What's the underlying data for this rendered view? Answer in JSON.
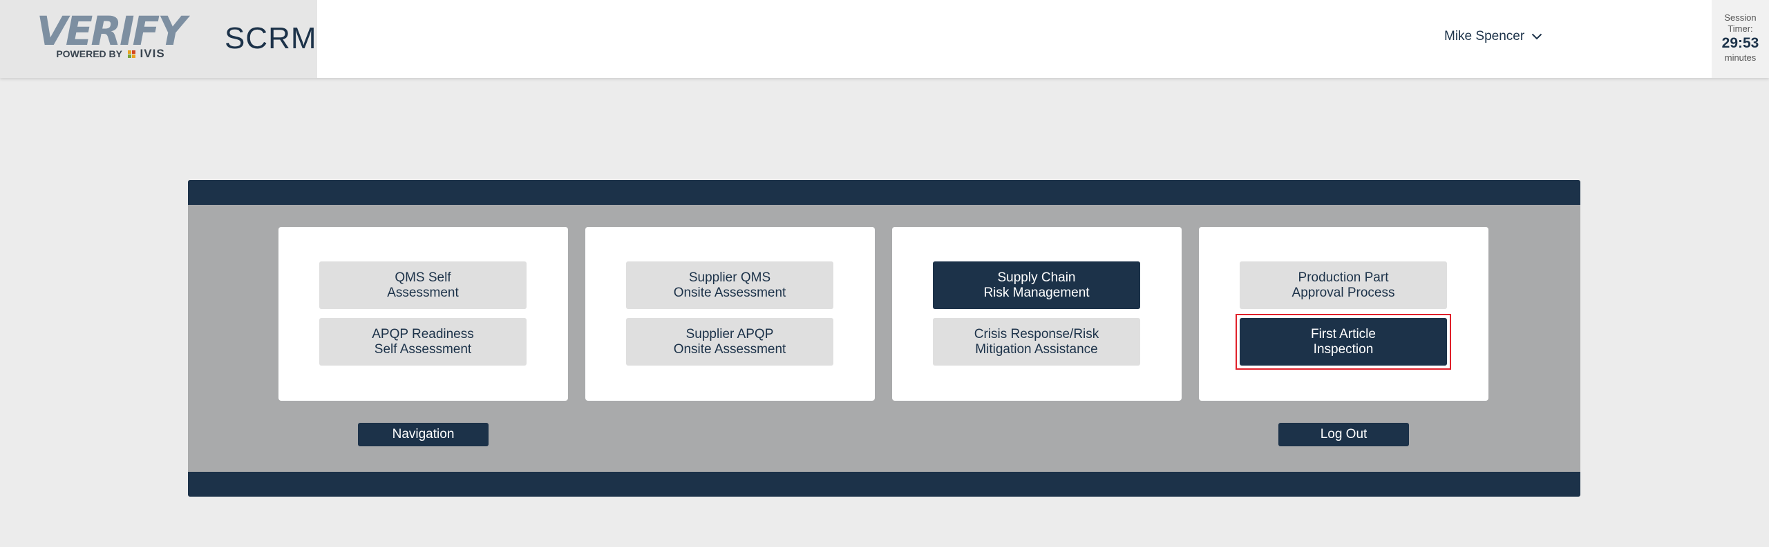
{
  "header": {
    "logo_word": "VERIFY",
    "logo_powered": "POWERED BY",
    "logo_ivis": "IVIS",
    "app_name": "SCRM",
    "user_name": "Mike Spencer",
    "session_label_1": "Session",
    "session_label_2": "Timer:",
    "session_time": "29:53",
    "session_unit": "minutes"
  },
  "cards": [
    {
      "tiles": [
        {
          "label": "QMS Self\nAssessment",
          "active": false
        },
        {
          "label": "APQP Readiness\nSelf Assessment",
          "active": false
        }
      ]
    },
    {
      "tiles": [
        {
          "label": "Supplier QMS\nOnsite Assessment",
          "active": false
        },
        {
          "label": "Supplier APQP\nOnsite Assessment",
          "active": false
        }
      ]
    },
    {
      "tiles": [
        {
          "label": "Supply Chain\nRisk Management",
          "active": true
        },
        {
          "label": "Crisis Response/Risk\nMitigation Assistance",
          "active": false
        }
      ]
    },
    {
      "tiles": [
        {
          "label": "Production Part\nApproval Process",
          "active": false
        },
        {
          "label": "First Article\nInspection",
          "active": true
        }
      ]
    }
  ],
  "buttons": {
    "navigation": "Navigation",
    "logout": "Log Out"
  },
  "colors": {
    "primary_navy": "#1c3249",
    "tile_gray": "#dfdfdf",
    "panel_gray": "#a9aaab",
    "focus_red": "#e0202a",
    "page_bg": "#ececec"
  },
  "icons": {
    "user_menu": "chevron-down-icon",
    "logo_mark": "ivis-squares-icon"
  }
}
